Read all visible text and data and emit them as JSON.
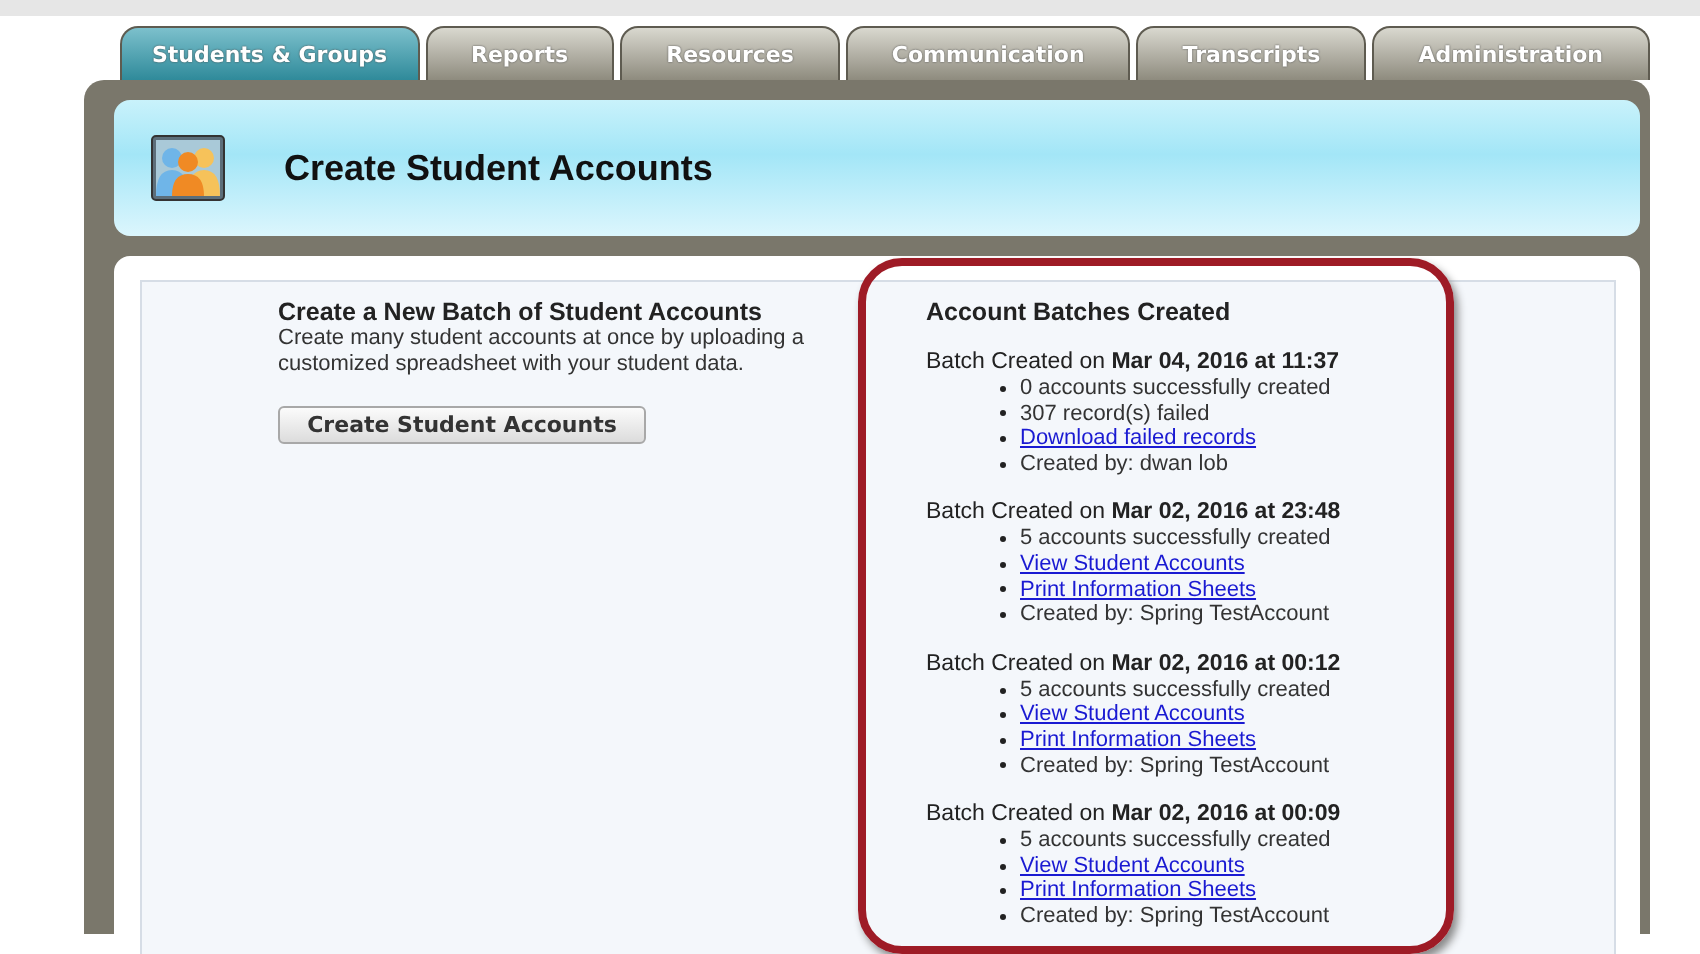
{
  "tabs": [
    {
      "label": "Students & Groups",
      "selected": true
    },
    {
      "label": "Reports",
      "selected": false
    },
    {
      "label": "Resources",
      "selected": false
    },
    {
      "label": "Communication",
      "selected": false
    },
    {
      "label": "Transcripts",
      "selected": false
    },
    {
      "label": "Administration",
      "selected": false
    }
  ],
  "header": {
    "title": "Create Student Accounts"
  },
  "create_section": {
    "title": "Create a New Batch of Student Accounts",
    "description": "Create many student accounts at once by uploading a customized spreadsheet with your student data.",
    "button": "Create Student Accounts"
  },
  "batches_section": {
    "title": "Account Batches Created",
    "highlighted": true,
    "batches": [
      {
        "heading": "Batch Created on **Mar 04, 2016 at 11:37**",
        "items": [
          {
            "kind": "text",
            "text": "0 accounts successfully created"
          },
          {
            "kind": "text",
            "text": "307 record(s) failed"
          },
          {
            "kind": "link",
            "text": "Download failed records"
          },
          {
            "kind": "text",
            "text": "Created by: dwan lob"
          }
        ]
      },
      {
        "heading": "Batch Created on **Mar 02, 2016 at 23:48**",
        "items": [
          {
            "kind": "text",
            "text": "5 accounts successfully created"
          },
          {
            "kind": "link",
            "text": "View Student Accounts"
          },
          {
            "kind": "link",
            "text": "Print Information Sheets"
          },
          {
            "kind": "text",
            "text": "Created by: Spring TestAccount"
          }
        ]
      },
      {
        "heading": "Batch Created on **Mar 02, 2016 at 00:12**",
        "items": [
          {
            "kind": "text",
            "text": "5 accounts successfully created"
          },
          {
            "kind": "link",
            "text": "View Student Accounts"
          },
          {
            "kind": "link",
            "text": "Print Information Sheets"
          },
          {
            "kind": "text",
            "text": "Created by: Spring TestAccount"
          }
        ]
      },
      {
        "heading": "Batch Created on **Mar 02, 2016 at 00:09**",
        "items": [
          {
            "kind": "text",
            "text": "5 accounts successfully created"
          },
          {
            "kind": "link",
            "text": "View Student Accounts"
          },
          {
            "kind": "link",
            "text": "Print Information Sheets"
          },
          {
            "kind": "text",
            "text": "Created by: Spring TestAccount"
          }
        ]
      }
    ]
  }
}
